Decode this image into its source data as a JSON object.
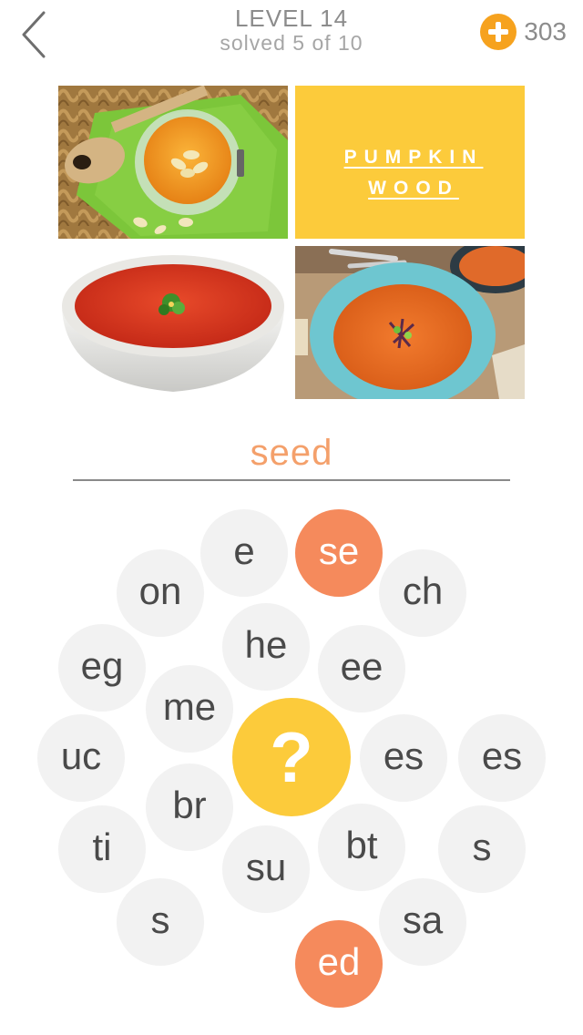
{
  "header": {
    "level_title": "LEVEL 14",
    "level_progress": "solved 5 of 10",
    "coins": "303"
  },
  "tiles": {
    "clue_card": {
      "line1": "PUMPKIN",
      "line2": "WOOD",
      "background": "#fccb3b"
    }
  },
  "answer": {
    "text": "seed",
    "color": "#f4a06b"
  },
  "hint": {
    "symbol": "?",
    "color": "#fccb3b"
  },
  "bubbles": [
    {
      "text": "e",
      "selected": false
    },
    {
      "text": "se",
      "selected": true
    },
    {
      "text": "on",
      "selected": false
    },
    {
      "text": "ch",
      "selected": false
    },
    {
      "text": "he",
      "selected": false
    },
    {
      "text": "eg",
      "selected": false
    },
    {
      "text": "ee",
      "selected": false
    },
    {
      "text": "me",
      "selected": false
    },
    {
      "text": "uc",
      "selected": false
    },
    {
      "text": "es",
      "selected": false
    },
    {
      "text": "es",
      "selected": false
    },
    {
      "text": "br",
      "selected": false
    },
    {
      "text": "ti",
      "selected": false
    },
    {
      "text": "bt",
      "selected": false
    },
    {
      "text": "su",
      "selected": false
    },
    {
      "text": "s",
      "selected": false
    },
    {
      "text": "s",
      "selected": false
    },
    {
      "text": "sa",
      "selected": false
    },
    {
      "text": "ed",
      "selected": true
    }
  ],
  "colors": {
    "selected_bubble": "#f58a5c",
    "bubble": "#f2f2f2",
    "coin": "#f6a21e"
  },
  "icons": {
    "back": "chevron-left-icon",
    "coin": "plus-coin-icon",
    "hint": "question-mark-icon"
  }
}
